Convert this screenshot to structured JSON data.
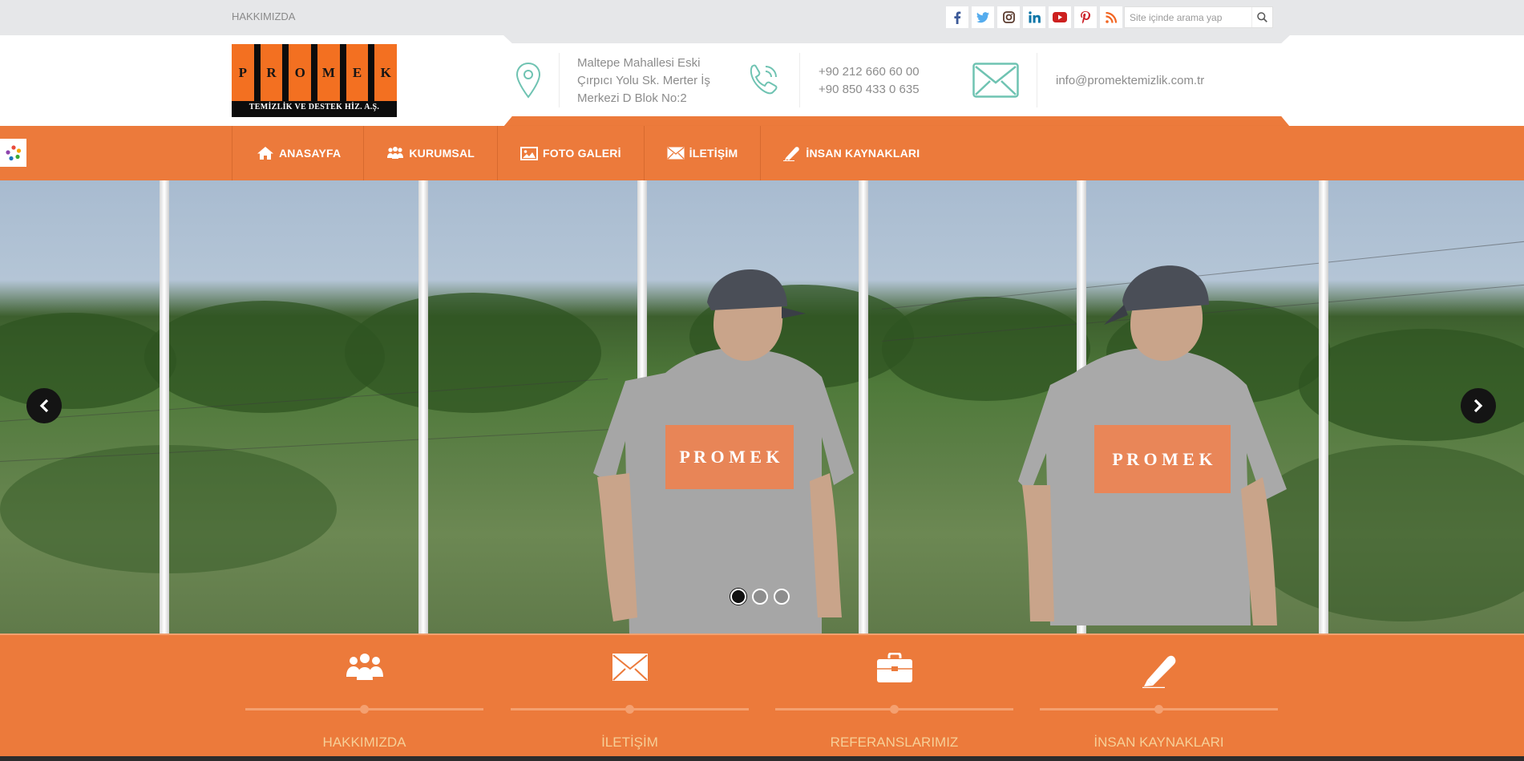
{
  "topbar": {
    "about_link": "HAKKIMIZDA",
    "search_placeholder": "Site içinde arama yap",
    "socials": [
      "facebook-icon",
      "twitter-icon",
      "instagram-icon",
      "linkedin-icon",
      "youtube-icon",
      "pinterest-icon",
      "rss-icon"
    ]
  },
  "logo": {
    "letters": [
      "P",
      "R",
      "O",
      "M",
      "E",
      "K"
    ],
    "subtitle": "TEMİZLİK VE DESTEK HİZ. A.Ş."
  },
  "contact": {
    "address_lines": [
      "Maltepe Mahallesi Eski",
      "Çırpıcı Yolu Sk. Merter İş",
      "Merkezi D Blok No:2"
    ],
    "phone_1": "+90 212 660 60 00",
    "phone_2": "+90 850 433 0 635",
    "email": "info@promektemizlik.com.tr"
  },
  "nav": {
    "items": [
      {
        "label": "ANASAYFA",
        "icon": "home-icon"
      },
      {
        "label": "KURUMSAL",
        "icon": "group-icon"
      },
      {
        "label": "FOTO GALERİ",
        "icon": "image-icon"
      },
      {
        "label": "İLETİŞİM",
        "icon": "envelope-icon"
      },
      {
        "label": "İNSAN KAYNAKLARI",
        "icon": "pencil-icon"
      }
    ]
  },
  "slider": {
    "shirt_text": "P R O M E K",
    "active_slide": 1,
    "slide_count": 3
  },
  "features": [
    {
      "label": "HAKKIMIZDA",
      "icon": "group-icon"
    },
    {
      "label": "İLETİŞİM",
      "icon": "envelope-icon"
    },
    {
      "label": "REFERANSLARIMIZ",
      "icon": "briefcase-icon"
    },
    {
      "label": "İNSAN KAYNAKLARI",
      "icon": "pencil-icon"
    }
  ],
  "colors": {
    "accent": "#ec7a3b",
    "topbar": "#e6e7e9",
    "feature_text": "#f6cf97",
    "contact_icon": "#6fc3b2"
  }
}
